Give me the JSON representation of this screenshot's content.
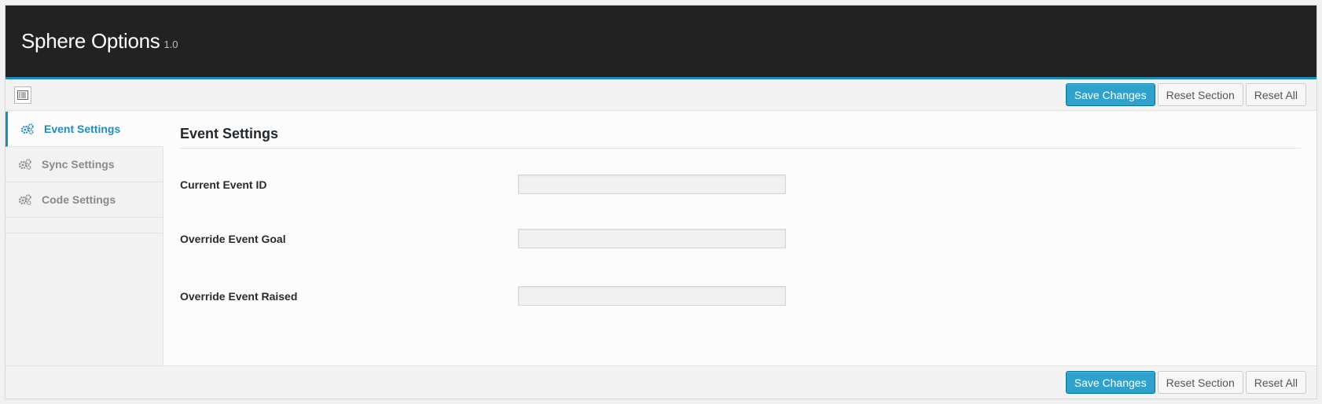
{
  "header": {
    "title": "Sphere Options",
    "version": "1.0"
  },
  "toolbar": {
    "expand_icon": "expand-icon",
    "save_label": "Save Changes",
    "reset_section_label": "Reset Section",
    "reset_all_label": "Reset All"
  },
  "sidebar": {
    "items": [
      {
        "label": "Event Settings",
        "icon": "gears-icon",
        "active": true
      },
      {
        "label": "Sync Settings",
        "icon": "gears-icon",
        "active": false
      },
      {
        "label": "Code Settings",
        "icon": "gears-icon",
        "active": false
      }
    ]
  },
  "main": {
    "section_title": "Event Settings",
    "fields": [
      {
        "label": "Current Event ID",
        "value": ""
      },
      {
        "label": "Override Event Goal",
        "value": ""
      },
      {
        "label": "Override Event Raised",
        "value": ""
      }
    ]
  },
  "colors": {
    "header_bg": "#222222",
    "accent": "#1e8cbe",
    "primary_button": "#2ea2cc"
  }
}
